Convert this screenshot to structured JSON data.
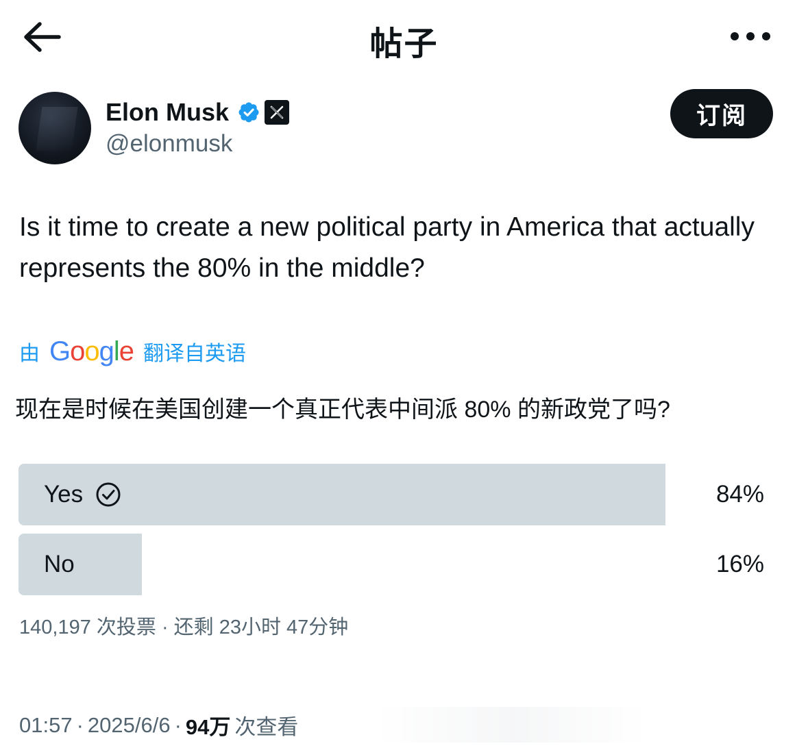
{
  "header": {
    "title": "帖子",
    "back_icon": "arrow-left-icon",
    "more_icon": "more-horizontal-icon"
  },
  "author": {
    "name": "Elon Musk",
    "handle": "@elonmusk",
    "verified_icon": "verified-badge-icon",
    "affiliate_icon": "x-logo-icon",
    "subscribe_label": "订阅"
  },
  "tweet": {
    "text": "Is it time to create a new political party in America that actually represents the 80% in the middle?",
    "translation_by": "由",
    "translation_provider": "Google",
    "translation_source": "翻译自英语",
    "translated_text": "现在是时候在美国创建一个真正代表中间派 80% 的新政党了吗?"
  },
  "poll": {
    "options": [
      {
        "label": "Yes",
        "percent": "84%",
        "share": 0.84,
        "selected": true,
        "icon": "check-circle-icon"
      },
      {
        "label": "No",
        "percent": "16%",
        "share": 0.16,
        "selected": false
      }
    ],
    "meta": "140,197 次投票 · 还剩 23小时 47分钟"
  },
  "post_meta": {
    "time": "01:57",
    "date": "2025/6/6",
    "views_count": "94万",
    "views_label": "次查看"
  },
  "colors": {
    "text_primary": "#0f1419",
    "text_secondary": "#536471",
    "link_blue": "#1d9bf0",
    "poll_fill": "#cfd9de",
    "verified_blue": "#1d9bf0"
  }
}
